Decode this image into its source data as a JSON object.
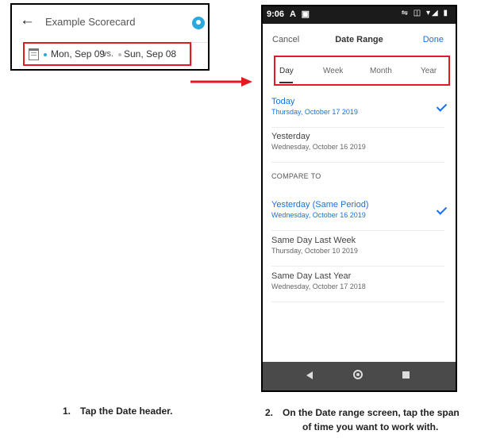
{
  "scorecard": {
    "title": "Example Scorecard",
    "back_icon": "arrow-left-icon",
    "date_primary": "Mon, Sep 09",
    "vs_label": "vs.",
    "date_compare": "Sun, Sep 08",
    "accent": "#2aa8e0",
    "highlight_color": "#e21b23"
  },
  "status_bar": {
    "time": "9:06",
    "left_icons": "A ▣",
    "right_icons": "⇋ ◫ ▾◢ ▮"
  },
  "date_range": {
    "cancel_label": "Cancel",
    "title": "Date Range",
    "done_label": "Done",
    "tabs": [
      {
        "label": "Day",
        "active": true
      },
      {
        "label": "Week",
        "active": false
      },
      {
        "label": "Month",
        "active": false
      },
      {
        "label": "Year",
        "active": false
      }
    ],
    "items": [
      {
        "title": "Today",
        "subtitle": "Thursday, October 17 2019",
        "selected": true
      },
      {
        "title": "Yesterday",
        "subtitle": "Wednesday, October 16 2019",
        "selected": false
      }
    ],
    "compare_label": "COMPARE TO",
    "compare_items": [
      {
        "title": "Yesterday (Same Period)",
        "subtitle": "Wednesday, October 16 2019",
        "selected": true
      },
      {
        "title": "Same Day Last Week",
        "subtitle": "Thursday, October 10 2019",
        "selected": false
      },
      {
        "title": "Same Day Last Year",
        "subtitle": "Wednesday, October 17 2018",
        "selected": false
      }
    ],
    "selected_color": "#1473e6"
  },
  "captions": {
    "step1_num": "1.",
    "step1_text": "Tap the Date header.",
    "step2_num": "2.",
    "step2_line1": "On the Date range screen, tap the span",
    "step2_line2": "of time you want to work with."
  }
}
